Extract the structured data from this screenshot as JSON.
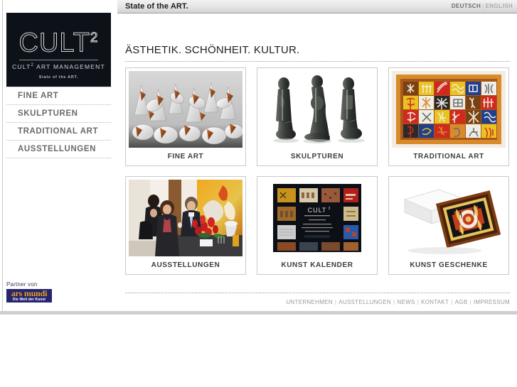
{
  "header": {
    "title": "State of the ART.",
    "lang_active": "DEUTSCH",
    "lang_inactive": "ENGLISH",
    "lang_separator": "|"
  },
  "logo": {
    "wordmark": "CULT",
    "wordmark_exponent": "2",
    "subtitle_before": "CULT",
    "subtitle_exponent": "2",
    "subtitle_after": " ART MANAGEMENT",
    "tagline": "State of the ART."
  },
  "sidebar": {
    "items": [
      {
        "label": "FINE ART",
        "name": "sidebar-item-fine-art"
      },
      {
        "label": "SKULPTUREN",
        "name": "sidebar-item-skulpturen"
      },
      {
        "label": "TRADITIONAL ART",
        "name": "sidebar-item-traditional-art"
      },
      {
        "label": "AUSSTELLUNGEN",
        "name": "sidebar-item-ausstellungen"
      }
    ],
    "partner_label": "Partner von",
    "partner_logo_top": "ars mundi",
    "partner_logo_bottom": "Die Welt der Kunst"
  },
  "main": {
    "headline": "ÄSTHETIK. SCHÖNHEIT. KULTUR.",
    "tiles": [
      {
        "caption": "FINE ART",
        "name": "tile-fine-art",
        "art": "fine-art"
      },
      {
        "caption": "SKULPTUREN",
        "name": "tile-skulpturen",
        "art": "skulpturen"
      },
      {
        "caption": "TRADITIONAL ART",
        "name": "tile-traditional-art",
        "art": "traditional-art"
      },
      {
        "caption": "AUSSTELLUNGEN",
        "name": "tile-ausstellungen",
        "art": "ausstellungen"
      },
      {
        "caption": "KUNST KALENDER",
        "name": "tile-kunst-kalender",
        "art": "kunst-kalender"
      },
      {
        "caption": "KUNST GESCHENKE",
        "name": "tile-kunst-geschenke",
        "art": "kunst-geschenke"
      }
    ]
  },
  "footer": {
    "links": [
      "UNTERNEHMEN",
      "AUSSTELLUNGEN",
      "NEWS",
      "KONTAKT",
      "AGB",
      "IMPRESSUM"
    ],
    "separator": "|"
  },
  "colors": {
    "logo_background": "#0d1118",
    "header_text": "#1d1d1d",
    "nav_text": "#6a6a6a",
    "partner_blue": "#26246e",
    "partner_orange": "#e8a01c",
    "tile_border": "#c9c9c9",
    "footer_text": "#9a9a9a"
  }
}
